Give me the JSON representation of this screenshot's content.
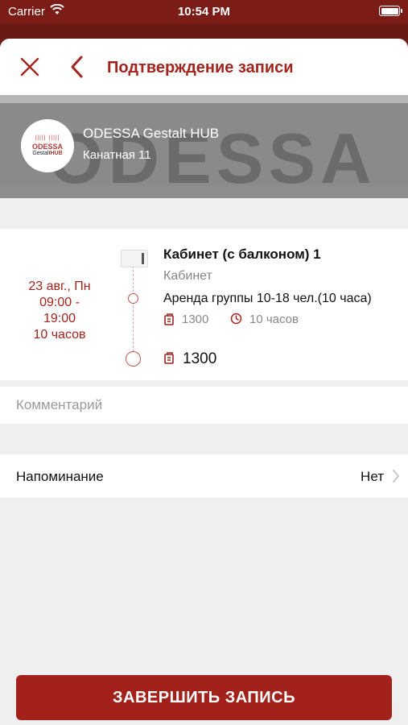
{
  "status_bar": {
    "carrier": "Carrier",
    "time": "10:54 PM"
  },
  "header": {
    "title": "Подтверждение записи"
  },
  "venue": {
    "name": "ODESSA Gestalt HUB",
    "address": "Канатная 11",
    "logo_text_1": "ODESSA",
    "logo_text_2a": "Gestalt",
    "logo_text_2b": "HUB",
    "background_text": "ODESSA"
  },
  "booking": {
    "date": "23 авг., Пн",
    "time_start": "09:00 -",
    "time_end": "19:00",
    "duration_label": "10 часов",
    "room_name": "Кабинет (с балконом) 1",
    "room_type": "Кабинет",
    "service": "Аренда группы 10-18 чел.(10 часа)",
    "service_price": "1300",
    "service_duration": "10 часов",
    "total": "1300"
  },
  "comment": {
    "placeholder": "Комментарий"
  },
  "reminder": {
    "label": "Напоминание",
    "value": "Нет"
  },
  "actions": {
    "finish_label": "ЗАВЕРШИТЬ ЗАПИСЬ"
  },
  "colors": {
    "accent": "#a3241d",
    "background": "#efefef"
  }
}
